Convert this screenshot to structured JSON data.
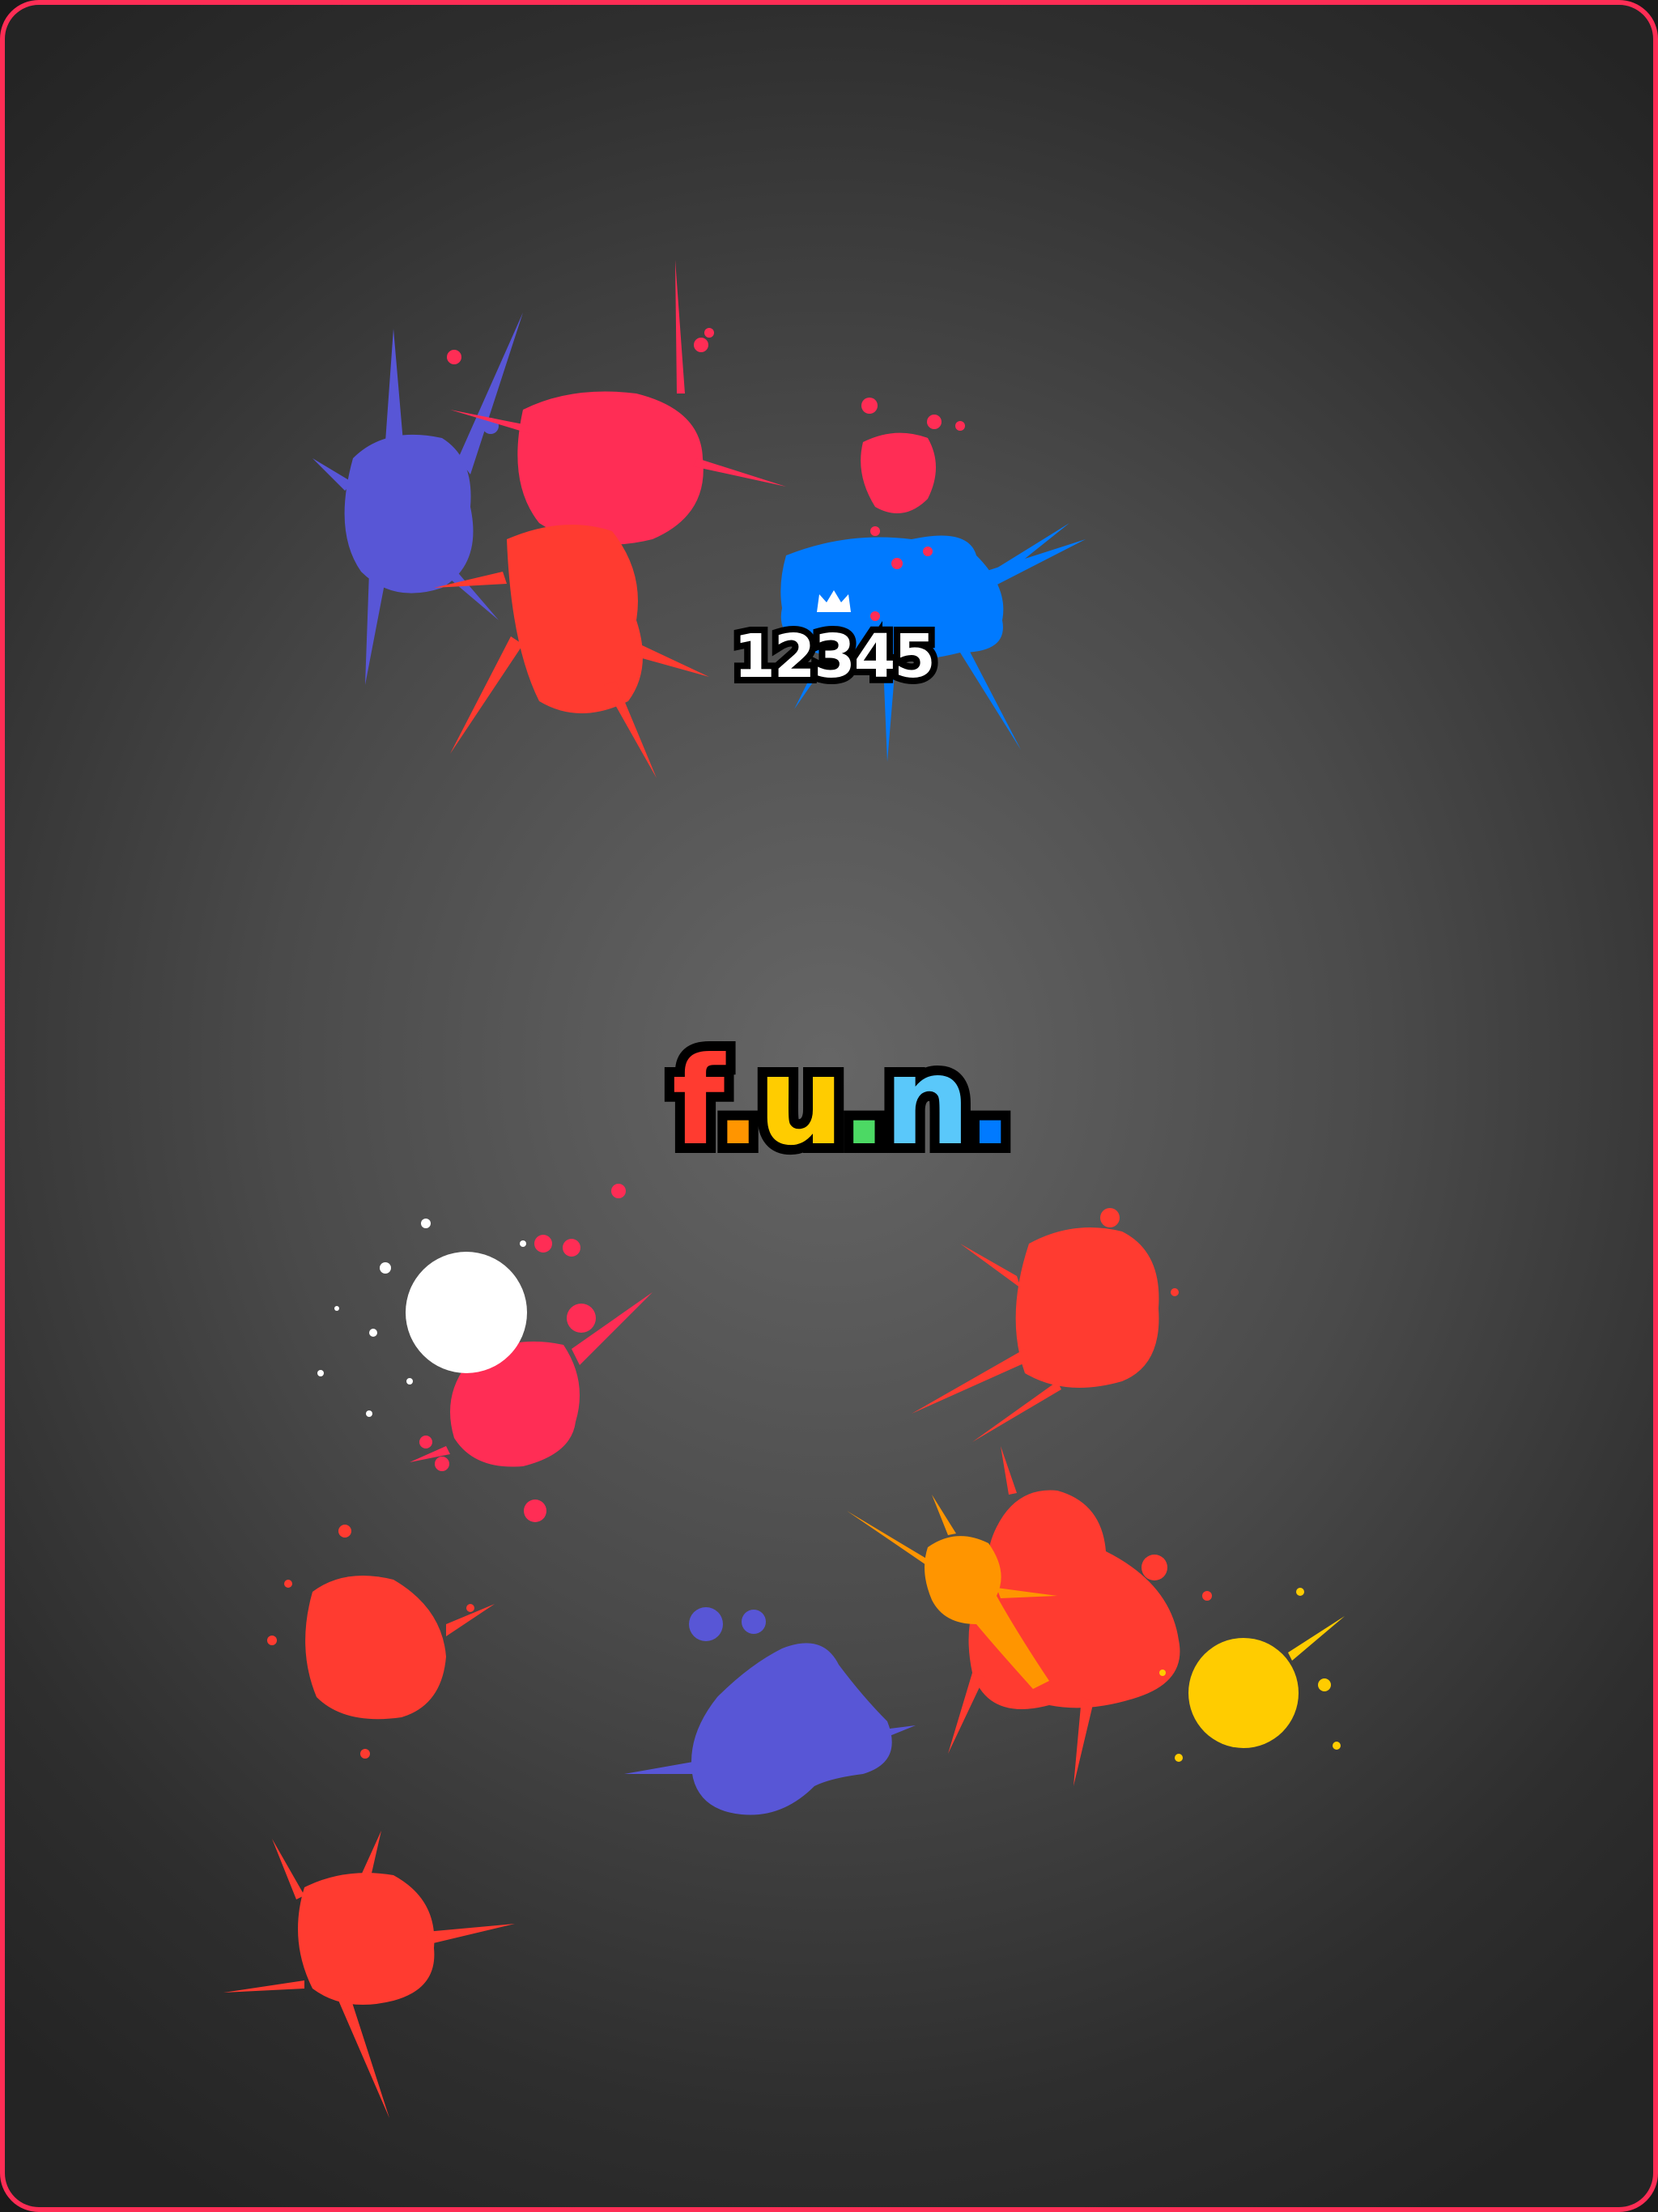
{
  "hud": {
    "score": "12345",
    "score_icon": "crown-icon"
  },
  "logo": {
    "letters": [
      {
        "char": "f",
        "color": "#ff3b30"
      },
      {
        "char": ".",
        "color": "#ff9500"
      },
      {
        "char": "u",
        "color": "#ffcc00"
      },
      {
        "char": ".",
        "color": "#4cd964"
      },
      {
        "char": "n",
        "color": "#5ac8fa"
      },
      {
        "char": ".",
        "color": "#007aff"
      }
    ]
  },
  "theme": {
    "frame_border": "#ff2d55",
    "background_center": "#666666",
    "background_edge": "#242424"
  },
  "paint_colors": {
    "red": "#ff3b30",
    "pink": "#ff2d55",
    "blue": "#007aff",
    "purple": "#5856d6",
    "orange": "#ff9500",
    "yellow": "#ffcc00",
    "white": "#ffffff"
  }
}
